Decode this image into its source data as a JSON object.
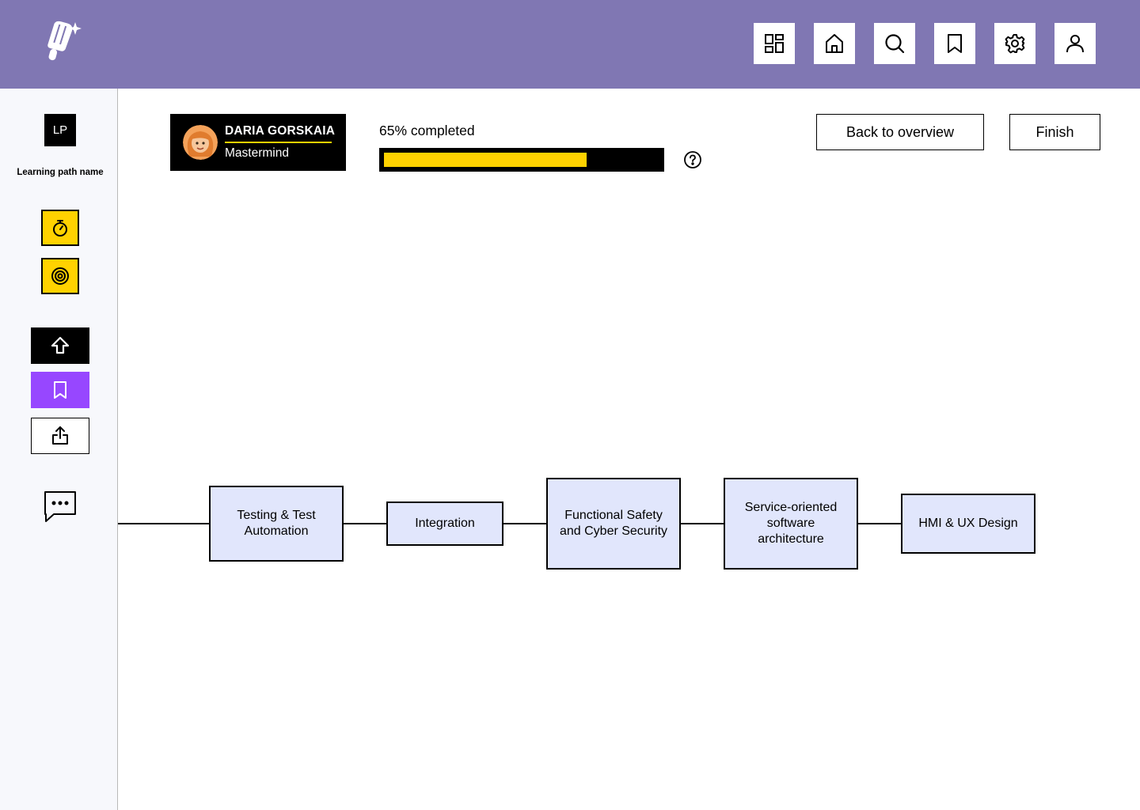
{
  "topbar": {
    "logo_icon": "brand-rocket-logo",
    "icons": [
      "dashboard-icon",
      "home-icon",
      "search-icon",
      "bookmark-icon",
      "settings-icon",
      "user-icon"
    ],
    "background": "#8077b3"
  },
  "sidebar": {
    "badge": "LP",
    "learning_path_name": "Learning path name",
    "tools": [
      "stopwatch-icon",
      "target-icon",
      "arrow-up-icon",
      "bookmark-icon",
      "share-icon",
      "chat-icon"
    ]
  },
  "user": {
    "name": "DARIA GORSKAIA",
    "rank": "Mastermind"
  },
  "progress": {
    "label": "65% completed",
    "value": 0.65
  },
  "actions": {
    "back_label": "Back to overview",
    "finish_label": "Finish"
  },
  "path": {
    "nodes": [
      {
        "label": "Testing & Test Automation"
      },
      {
        "label": "Integration"
      },
      {
        "label": "Functional Safety and Cyber Security"
      },
      {
        "label": "Service-oriented software architecture"
      },
      {
        "label": "HMI & UX Design"
      }
    ]
  },
  "colors": {
    "accent_yellow": "#ffd200",
    "node_fill": "#e1e6fc",
    "bookmark_purple": "#9747ff"
  }
}
